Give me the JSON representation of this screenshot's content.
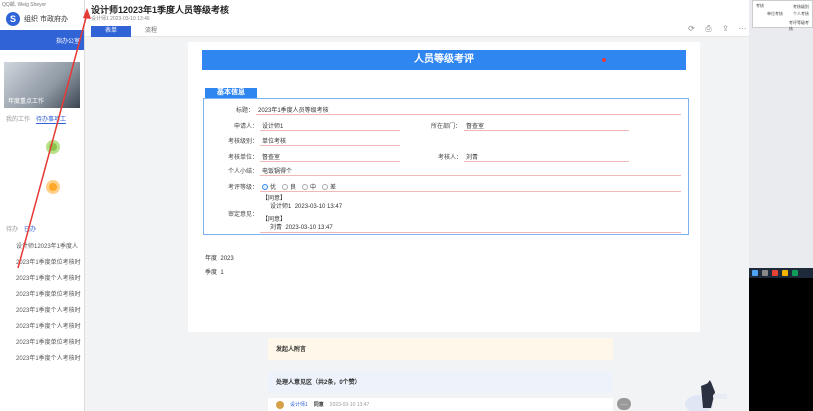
{
  "left_app": {
    "topstrip": "QQ邮, Weig  Sheyor",
    "brand_logo": "S",
    "brand": "组织   市政府办",
    "nav_label": "指办公室",
    "banner_caption": "年度重点工作",
    "tabs": [
      "我的工作",
      "待办事项工"
    ],
    "tabs2": [
      "待办",
      "已办"
    ],
    "list": [
      "设计师12023年1季度人",
      "2023年1季度单位考核时",
      "2023年1季度个人考核时",
      "2023年1季度单位考核时",
      "2023年1季度个人考核时",
      "2023年1季度个人考核时",
      "2023年1季度单位考核时",
      "2023年1季度个人考核时"
    ]
  },
  "modal": {
    "title": "设计师12023年1季度人员等级考核",
    "meta": "设计师1    2023-03-10 13:46",
    "tabs": [
      "表单",
      "流程"
    ],
    "icons": [
      "refresh-icon",
      "print-icon",
      "export-icon",
      "more-icon"
    ]
  },
  "doc": {
    "header": "人员等级考评",
    "section": "基本信息",
    "fields": {
      "title_label": "标题：",
      "title_value": "2023年1季度人员等级考核",
      "applicant_label": "申请人：",
      "applicant_value": "设计师1",
      "dept_label": "所在部门：",
      "dept_value": "督查室",
      "level_label": "考核级别：",
      "level_value": "单位考核",
      "unit_label": "考核单位：",
      "unit_value": "督查室",
      "reviewer_label": "考核人：",
      "reviewer_value": "刘青",
      "summary_label": "个人小结：",
      "summary_value": "电饭锅得个",
      "grade_label": "考评等级：",
      "grades": [
        "优",
        "良",
        "中",
        "差"
      ],
      "selected_grade": "优",
      "opinion_label": "审定意见："
    },
    "opinions": [
      {
        "tag": "【同意】",
        "signer": "设计师1",
        "time": "2023-03-10 13:47"
      },
      {
        "tag": "【同意】",
        "signer": "刘青",
        "time": "2023-03-10 13:47"
      }
    ],
    "year_label": "年度",
    "year_value": "2023",
    "quarter_label": "季度",
    "quarter_value": "1"
  },
  "attachments": {
    "label": "发起人附言"
  },
  "handlers": {
    "label": "处理人意见区（共2条，0个赞）",
    "row": {
      "name": "设计师1",
      "action": "同意",
      "time": "2023-03-10 13:47"
    }
  },
  "right_popup": {
    "rows": [
      "考核",
      "考核级别",
      "单位考核",
      "个人考核",
      "考评等级考核"
    ]
  },
  "colors": {
    "primary": "#2f63d6",
    "title_bar": "#2f86f0",
    "annotation": "#e53935"
  }
}
